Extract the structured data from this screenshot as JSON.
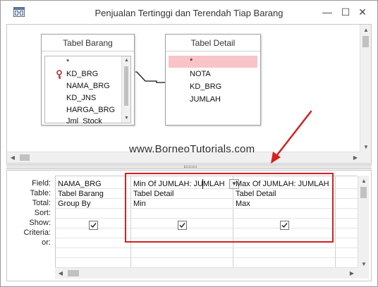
{
  "window": {
    "title": "Penjualan Tertinggi dan Terendah Tiap Barang",
    "minimize_symbol": "—",
    "maximize_symbol": "☐",
    "close_symbol": "✕"
  },
  "tables": [
    {
      "title": "Tabel Barang",
      "fields": [
        {
          "name": "*",
          "is_key": false,
          "selected": false
        },
        {
          "name": "KD_BRG",
          "is_key": true,
          "selected": false
        },
        {
          "name": "NAMA_BRG",
          "is_key": false,
          "selected": false
        },
        {
          "name": "KD_JNS",
          "is_key": false,
          "selected": false
        },
        {
          "name": "HARGA_BRG",
          "is_key": false,
          "selected": false
        },
        {
          "name": "Jml_Stock",
          "is_key": false,
          "selected": false
        }
      ]
    },
    {
      "title": "Tabel Detail",
      "fields": [
        {
          "name": "*",
          "is_key": false,
          "selected": true
        },
        {
          "name": "NOTA",
          "is_key": false,
          "selected": false
        },
        {
          "name": "KD_BRG",
          "is_key": false,
          "selected": false
        },
        {
          "name": "JUMLAH",
          "is_key": false,
          "selected": false
        }
      ]
    }
  ],
  "watermark": "www.BorneoTutorials.com",
  "grid": {
    "row_labels": {
      "field": "Field:",
      "table": "Table:",
      "total": "Total:",
      "sort": "Sort:",
      "show": "Show:",
      "criteria": "Criteria:",
      "or": "or:"
    },
    "columns": [
      {
        "field": "NAMA_BRG",
        "table": "Tabel Barang",
        "total": "Group By",
        "sort": "",
        "show": true
      },
      {
        "field": "Min Of JUMLAH: JUMLAH",
        "table": "Tabel Detail",
        "total": "Min",
        "sort": "",
        "show": true
      },
      {
        "field": "Max Of JUMLAH: JUMLAH",
        "table": "Tabel Detail",
        "total": "Max",
        "sort": "",
        "show": true
      }
    ]
  },
  "icons": {
    "title_icon": "query-design-icon",
    "key_icon": "primary-key-icon",
    "dropdown_icon": "chevron-down-icon",
    "checkbox_icon": "checkmark-icon"
  },
  "colors": {
    "annotation_red": "#d42020",
    "selected_field_bg": "#f9c4c8",
    "key_icon": "#b03030"
  }
}
